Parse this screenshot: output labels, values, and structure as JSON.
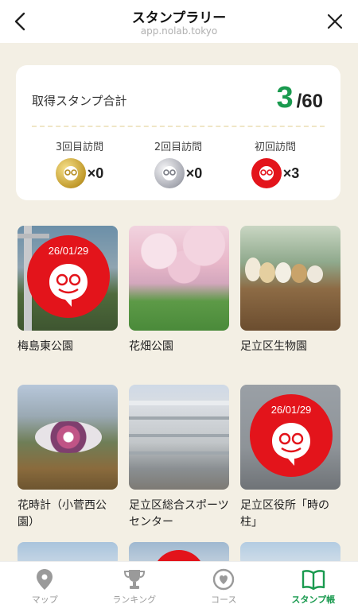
{
  "header": {
    "title": "スタンプラリー",
    "url": "app.nolab.tokyo"
  },
  "summary": {
    "label": "取得スタンプ合計",
    "count": "3",
    "total": "/60",
    "accent_color": "#1a9a4f",
    "visits": [
      {
        "label": "3回目訪問",
        "count": "×0",
        "medal": "gold"
      },
      {
        "label": "2回目訪問",
        "count": "×0",
        "medal": "silver"
      },
      {
        "label": "初回訪問",
        "count": "×3",
        "medal": "red"
      }
    ]
  },
  "spots": [
    {
      "name": "梅島東公園",
      "stamp_date": "26/01/29",
      "photo": "park"
    },
    {
      "name": "花畑公園",
      "stamp_date": "",
      "photo": "sakura"
    },
    {
      "name": "足立区生物園",
      "stamp_date": "",
      "photo": "guineapig"
    },
    {
      "name": "花時計（小菅西公園）",
      "stamp_date": "",
      "photo": "flowerclock"
    },
    {
      "name": "足立区総合スポーツセンター",
      "stamp_date": "",
      "photo": "building"
    },
    {
      "name": "足立区役所「時の柱」",
      "stamp_date": "26/01/29",
      "photo": "tower"
    }
  ],
  "nav": [
    {
      "label": "マップ",
      "icon": "map-pin-icon",
      "active": false
    },
    {
      "label": "ランキング",
      "icon": "trophy-icon",
      "active": false
    },
    {
      "label": "コース",
      "icon": "heart-circle-icon",
      "active": false
    },
    {
      "label": "スタンプ帳",
      "icon": "book-icon",
      "active": true
    }
  ]
}
